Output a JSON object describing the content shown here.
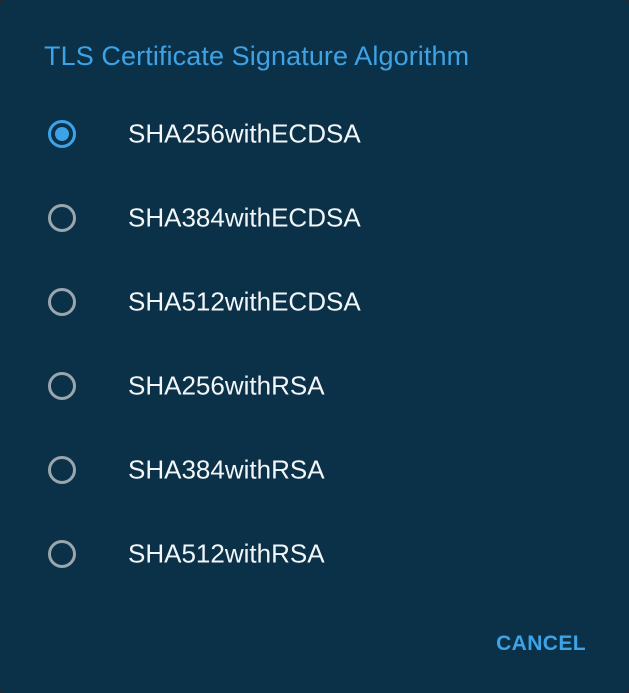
{
  "dialog": {
    "title": "TLS Certificate Signature Algorithm",
    "options": [
      {
        "label": "SHA256withECDSA",
        "selected": true
      },
      {
        "label": "SHA384withECDSA",
        "selected": false
      },
      {
        "label": "SHA512withECDSA",
        "selected": false
      },
      {
        "label": "SHA256withRSA",
        "selected": false
      },
      {
        "label": "SHA384withRSA",
        "selected": false
      },
      {
        "label": "SHA512withRSA",
        "selected": false
      }
    ],
    "cancel_label": "CANCEL"
  },
  "colors": {
    "dialog_background": "#0b3148",
    "accent": "#3ea3e6",
    "text": "#f3f6f8",
    "radio_unchecked": "#9aa6ad"
  }
}
